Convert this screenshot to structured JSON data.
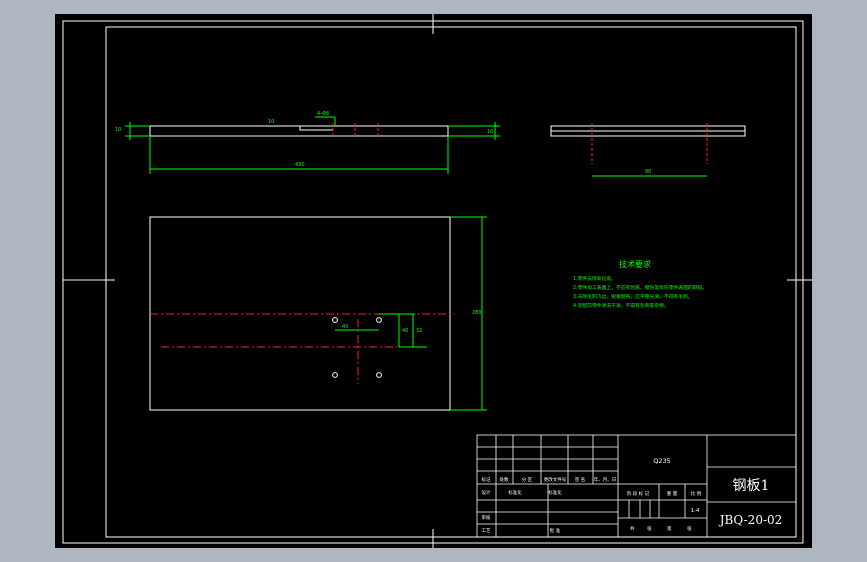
{
  "title_block": {
    "material": "Q235",
    "part_name": "钢板1",
    "drawing_number": "JBQ-20-02",
    "scale": "1:4",
    "row_labels": [
      "标记",
      "处数",
      "分 区",
      "更改文件号",
      "签 名",
      "年、月、日"
    ],
    "designer_label": "设计",
    "std_label": "标准化",
    "standardization_label": "标准化",
    "stage_label": "阶 段 标 记",
    "weight_label": "重 量",
    "scale_label": "比 例",
    "review_label": "审核",
    "process_label": "工艺",
    "approve_label": "批 准",
    "sheet_labels": [
      "共",
      "张",
      "第",
      "张"
    ]
  },
  "tech_requirements": {
    "title": "技术要求",
    "items": [
      "1.零件去除氧化皮。",
      "2.零件加工表面上，不应有划痕、擦伤等损伤零件表面的缺陷。",
      "3.去除毛刺飞边，锐角倒钝，应平整光滑，不得有毛刺。",
      "4.装配前零件清洗干净，不得有毛刺等杂物。"
    ]
  },
  "dimensions": {
    "top_left_height": "10",
    "top_right_height": "10",
    "top_length": "430",
    "top_hole_label": "4-Φ8",
    "step_label": "10",
    "right_view_width": "80",
    "plan_height": "280",
    "hole_spacing_x": "40",
    "hole_offset_y": "40",
    "hole_offset_y2": "32"
  }
}
